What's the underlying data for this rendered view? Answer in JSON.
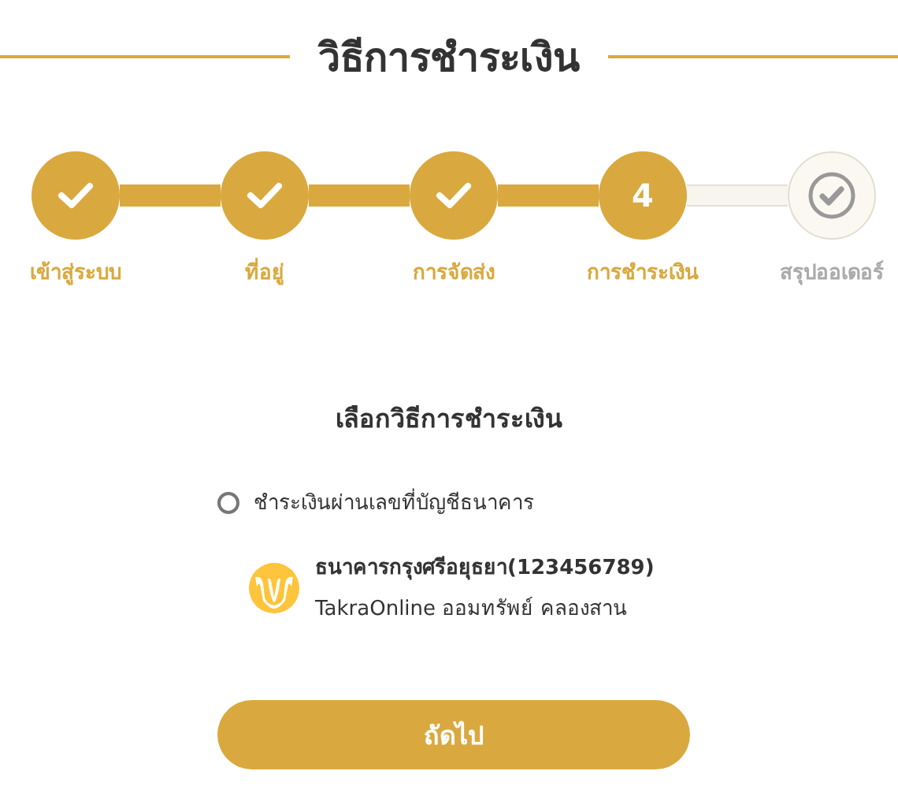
{
  "title": "วิธีการชำระเงิน",
  "steps": [
    {
      "label": "เข้าสู่ระบบ",
      "done": true,
      "current": false
    },
    {
      "label": "ที่อยู่",
      "done": true,
      "current": false
    },
    {
      "label": "การจัดส่ง",
      "done": true,
      "current": false
    },
    {
      "label": "การชำระเงิน",
      "done": false,
      "current": true,
      "number": "4"
    },
    {
      "label": "สรุปออเดอร์",
      "done": false,
      "current": false
    }
  ],
  "section_title": "เลือกวิธีการชำระเงิน",
  "payment_options": [
    {
      "label": "ชำระเงินผ่านเลขที่บัญชีธนาคาร",
      "selected": false,
      "bank_name": "ธนาคารกรุงศรีอยุธยา(123456789)",
      "account_name": "TakraOnline ออมทรัพย์ คลองสาน"
    }
  ],
  "next_button": "ถัดไป"
}
